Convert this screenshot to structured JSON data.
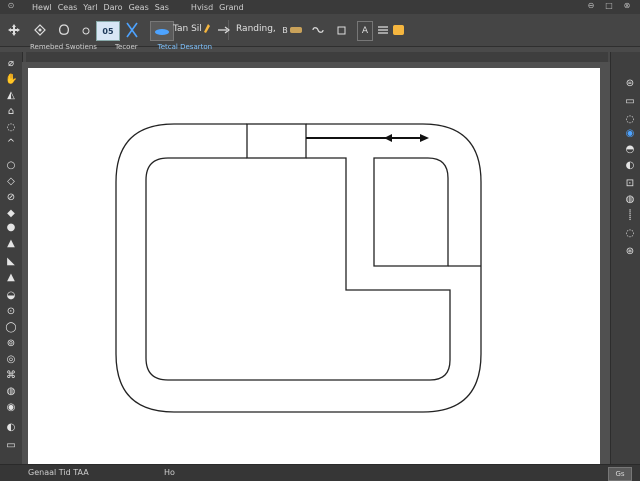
{
  "menubar": {
    "items": [
      "Hewl",
      "Ceas",
      "Yarl",
      "Daro",
      "Geas",
      "Sas",
      "Hvisd",
      "Grand"
    ]
  },
  "options": {
    "size_label": "05",
    "font_label": "Tan Sil",
    "style_label": "Randing,"
  },
  "docbar": {
    "tabs": [
      "Remebed Swotiens",
      "Tecoer",
      "Tetcal Desarton"
    ],
    "active": "Tetcal Desarton"
  },
  "status": {
    "text": "Genaal Tid TAA",
    "right": "Ho",
    "sheet_label": "Gs"
  },
  "colors": {
    "chrome": "#3a3a3a",
    "options_bg": "#454545",
    "artboard": "#ffffff",
    "accent": "#4da3ff",
    "swatch": "#f5b63f"
  }
}
